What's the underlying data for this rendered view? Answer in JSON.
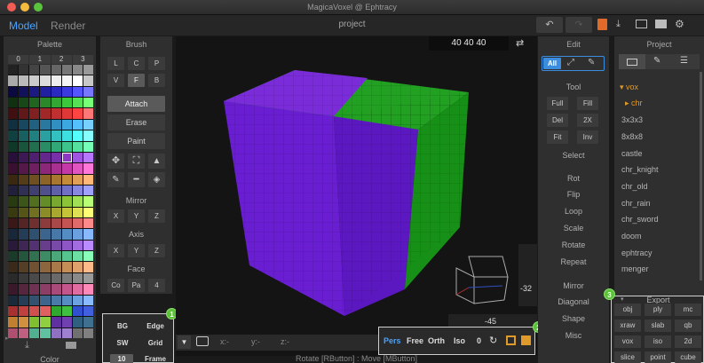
{
  "window": {
    "title": "MagicaVoxel @ Ephtracy"
  },
  "topbar": {
    "modes": [
      "Model",
      "Render"
    ],
    "project_name": "project",
    "icons": [
      "undo-icon",
      "redo-icon",
      "save-icon",
      "export-icon",
      "open-folder-icon",
      "folder-icon",
      "settings-icon"
    ]
  },
  "palette": {
    "header": "Palette",
    "pages": [
      "0",
      "1",
      "2",
      "3"
    ],
    "footer": "Color",
    "colors": [
      "#222222",
      "#333333",
      "#444444",
      "#555555",
      "#666666",
      "#777777",
      "#888888",
      "#999999",
      "#aaaaaa",
      "#bbbbbb",
      "#cccccc",
      "#dddddd",
      "#eeeeee",
      "#f5f5f5",
      "#ffffff",
      "#c8c8c8",
      "#0a0a40",
      "#12125a",
      "#1a1a80",
      "#2020a0",
      "#2a2ac0",
      "#3a3ae0",
      "#5555ff",
      "#7777ff",
      "#103010",
      "#184818",
      "#206620",
      "#2a882a",
      "#32a832",
      "#3cc83c",
      "#55e055",
      "#77ff77",
      "#401010",
      "#601818",
      "#802020",
      "#a02828",
      "#c03030",
      "#e03838",
      "#ff4444",
      "#ff7777",
      "#103040",
      "#184860",
      "#206080",
      "#2a78a0",
      "#3290c0",
      "#3ca8e0",
      "#55c0ff",
      "#77d0ff",
      "#104040",
      "#186060",
      "#208080",
      "#2aa0a0",
      "#32c0c0",
      "#3ce0e0",
      "#55ffff",
      "#88ffff",
      "#103828",
      "#18553c",
      "#207050",
      "#2a8c64",
      "#32a878",
      "#3cc48c",
      "#55e0a0",
      "#77ffb8",
      "#28103a",
      "#3c1855",
      "#502070",
      "#64288c",
      "#7830a8",
      "#8c38c4",
      "#a055e0",
      "#b877ff",
      "#3a1030",
      "#551848",
      "#702060",
      "#8c2878",
      "#a83090",
      "#c438a8",
      "#e055c0",
      "#ff77d8",
      "#3a2810",
      "#553c18",
      "#705020",
      "#8c6428",
      "#a87830",
      "#c48c38",
      "#e0a055",
      "#ffb877",
      "#20203a",
      "#303055",
      "#404070",
      "#50508c",
      "#6060a8",
      "#7070c4",
      "#8888e0",
      "#a0a0ff",
      "#283a10",
      "#3c5518",
      "#507020",
      "#648c28",
      "#78a830",
      "#8cc438",
      "#a0e055",
      "#b8ff77",
      "#3a3a10",
      "#555518",
      "#707020",
      "#8c8c28",
      "#a8a830",
      "#c4c438",
      "#e0e055",
      "#ffff77",
      "#3a1818",
      "#552424",
      "#703030",
      "#8c3c3c",
      "#a84848",
      "#c45454",
      "#e06a6a",
      "#ff8888",
      "#18283a",
      "#243c55",
      "#305070",
      "#3c648c",
      "#4878a8",
      "#548cc4",
      "#6aa0e0",
      "#88b8ff",
      "#2a1a3a",
      "#3e2655",
      "#523270",
      "#663e8c",
      "#7a4aa8",
      "#8e56c4",
      "#a26ce0",
      "#ba8aff",
      "#1a3a2a",
      "#26553e",
      "#327052",
      "#3e8c66",
      "#4aa87a",
      "#56c48e",
      "#6ce0a2",
      "#8affba",
      "#3a2a1a",
      "#553e26",
      "#705232",
      "#8c663e",
      "#a87a4a",
      "#c48e56",
      "#e0a26c",
      "#ffba8a",
      "#2a2a2a",
      "#3a3a3a",
      "#4a4a4a",
      "#5a5a5a",
      "#6a6a6a",
      "#7a7a7a",
      "#8a8a8a",
      "#9a9a9a",
      "#3a1a2a",
      "#55263e",
      "#703252",
      "#8c3e66",
      "#a84a7a",
      "#c4568e",
      "#e06ca2",
      "#ff8aba",
      "#1a2a3a",
      "#263e55",
      "#325270",
      "#3e668c",
      "#4a7aa8",
      "#568ec4",
      "#6ca2e0",
      "#8abaff",
      "#a83030",
      "#c04040",
      "#d05050",
      "#e06060",
      "#30a830",
      "#40c040",
      "#3050d0",
      "#4060e0",
      "#c08030",
      "#d09040",
      "#80c030",
      "#90d040",
      "#6030a0",
      "#7040b0",
      "#306080",
      "#407090",
      "#b05070",
      "#c06080",
      "#50b090",
      "#60c0a0",
      "#9070c0",
      "#a080d0",
      "#707070",
      "#808080"
    ],
    "selected_index": 69
  },
  "brush": {
    "header": "Brush",
    "modes_row1": [
      "L",
      "C",
      "P"
    ],
    "modes_row2": [
      "V",
      "F",
      "B"
    ],
    "actions": [
      "Attach",
      "Erase",
      "Paint"
    ],
    "tool_icons": [
      "move-icon",
      "select-box-icon",
      "fill-icon",
      "eyedropper-icon",
      "brush-icon",
      "bucket-icon"
    ],
    "mirror": {
      "label": "Mirror",
      "axes": [
        "X",
        "Y",
        "Z"
      ]
    },
    "axis": {
      "label": "Axis",
      "axes": [
        "X",
        "Y",
        "Z"
      ]
    },
    "face": {
      "label": "Face",
      "buttons": [
        "Co",
        "Pa",
        "4"
      ]
    }
  },
  "display": {
    "buttons": [
      "BG",
      "Edge",
      "SW",
      "Grid",
      "10",
      "Frame"
    ],
    "badge": "1"
  },
  "viewport": {
    "size": "40 40 40",
    "coords": [
      "x:-",
      "y:-",
      "z:-"
    ],
    "ruler_right": "-32",
    "ruler_bottom": "-45",
    "status": "Rotate [RButton] : Move [MButton]",
    "camera": {
      "modes": [
        "Pers",
        "Free",
        "Orth",
        "Iso"
      ],
      "value": "0",
      "badge": "2"
    }
  },
  "edit": {
    "header": "Edit",
    "filter": [
      "All"
    ],
    "tool": {
      "label": "Tool",
      "buttons": [
        "Full",
        "Fill",
        "Del",
        "2X",
        "Fit",
        "Inv"
      ]
    },
    "select_label": "Select",
    "ops": [
      "Rot",
      "Flip",
      "Loop",
      "Scale",
      "Rotate",
      "Repeat"
    ],
    "gen": [
      "Mirror",
      "Diagonal",
      "Shape",
      "Misc"
    ]
  },
  "project": {
    "header": "Project",
    "tree": [
      {
        "label": "vox",
        "open": true,
        "highlight": true
      },
      {
        "label": "chr",
        "open": false,
        "highlight": true,
        "indent": true
      }
    ],
    "files": [
      "3x3x3",
      "8x8x8",
      "castle",
      "chr_knight",
      "chr_old",
      "chr_rain",
      "chr_sword",
      "doom",
      "ephtracy",
      "menger"
    ]
  },
  "export": {
    "label": "Export",
    "badge": "3",
    "formats": [
      "obj",
      "ply",
      "mc",
      "xraw",
      "slab",
      "qb",
      "vox",
      "iso",
      "2d",
      "slice",
      "point",
      "cube"
    ]
  },
  "colors": {
    "accent_blue": "#3b8de0",
    "accent_orange": "#e09a2a",
    "cube_purple": "#6a1ed2",
    "cube_green": "#1aa01a"
  }
}
